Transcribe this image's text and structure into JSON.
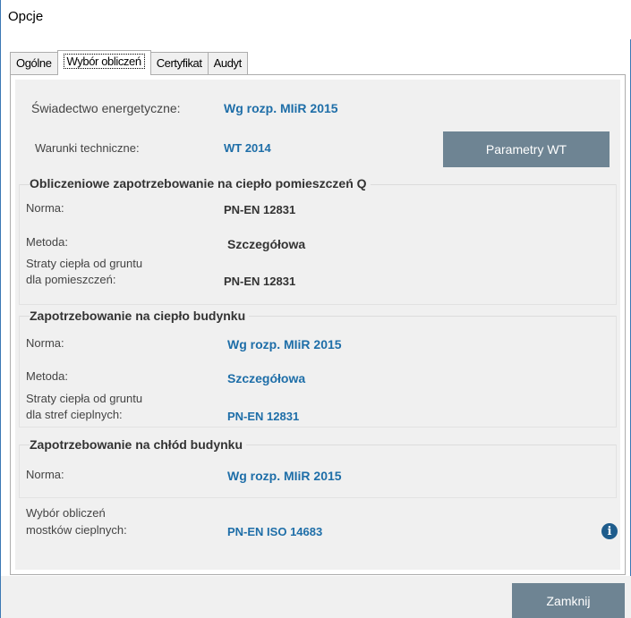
{
  "window": {
    "title": "Opcje"
  },
  "tabs": [
    {
      "label": "Ogólne",
      "active": false
    },
    {
      "label": "Wybór obliczeń",
      "active": true
    },
    {
      "label": "Certyfikat",
      "active": false
    },
    {
      "label": "Audyt",
      "active": false
    }
  ],
  "general": {
    "certificate_label": "Świadectwo energetyczne:",
    "certificate_value": "Wg rozp. MIiR 2015",
    "technical_label": "Warunki techniczne:",
    "technical_value": "WT 2014",
    "wt_button": "Parametry WT"
  },
  "room_heat": {
    "title": "Obliczeniowe zapotrzebowanie na ciepło pomieszczeń Q",
    "norm_label": "Norma:",
    "norm_value": "PN-EN 12831",
    "method_label": "Metoda:",
    "method_value": "Szczegółowa",
    "ground_label_1": "Straty ciepła od gruntu",
    "ground_label_2": "dla pomieszczeń:",
    "ground_value": "PN-EN 12831"
  },
  "building_heat": {
    "title": "Zapotrzebowanie na ciepło budynku",
    "norm_label": "Norma:",
    "norm_value": "Wg rozp. MIiR 2015",
    "method_label": "Metoda:",
    "method_value": "Szczegółowa",
    "ground_label_1": "Straty ciepła od gruntu",
    "ground_label_2": "dla stref cieplnych:",
    "ground_value": "PN-EN 12831"
  },
  "building_cooling": {
    "title": "Zapotrzebowanie na chłód budynku",
    "norm_label": "Norma:",
    "norm_value": "Wg rozp. MIiR 2015"
  },
  "thermal_bridges": {
    "label_1": "Wybór obliczeń",
    "label_2": "mostków cieplnych:",
    "value": "PN-EN ISO 14683",
    "info_icon": "i"
  },
  "footer": {
    "close_button": "Zamknij"
  },
  "colors": {
    "accent": "#1e6ea8",
    "button": "#6e8493",
    "panel_bg": "#f0f0f0"
  }
}
